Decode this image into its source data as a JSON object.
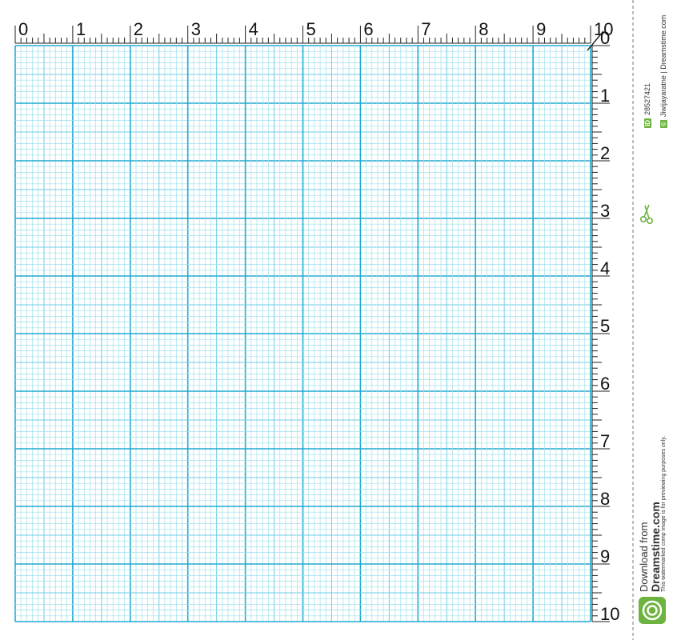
{
  "ruler": {
    "top_labels": [
      "0",
      "1",
      "2",
      "3",
      "4",
      "5",
      "6",
      "7",
      "8",
      "9",
      "10"
    ],
    "right_labels": [
      "0",
      "1",
      "2",
      "3",
      "4",
      "5",
      "6",
      "7",
      "8",
      "9",
      "10"
    ]
  },
  "colors": {
    "grid_minor": "#9fe0ec",
    "grid_major": "#22aacf",
    "grid_background": "#ffffff",
    "ruler_ink": "#222222",
    "brand_green": "#6cb33f"
  },
  "watermark": {
    "id_badge": "ID",
    "id_number": "28527421",
    "credit_badge": "©",
    "credit": "Jiwijayaratne | Dreamstime.com",
    "note": "This watermarked comp image is for previewing purposes only.",
    "download_from": "Download from",
    "brand": "Dreamstime.com"
  },
  "icons": {
    "scissors": "scissors-icon",
    "logo": "dreamstime-logo-icon"
  }
}
